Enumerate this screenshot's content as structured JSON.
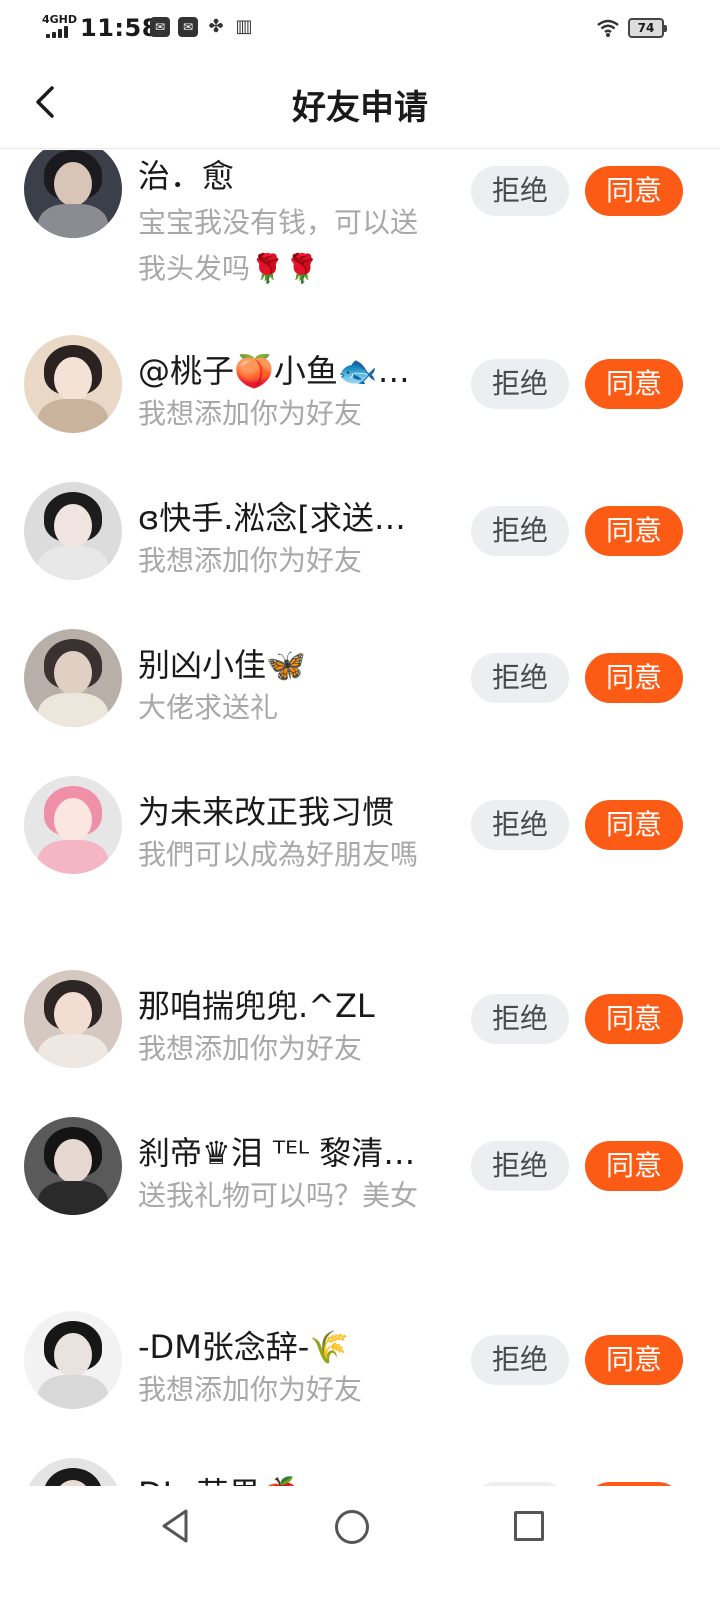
{
  "status_bar": {
    "network": "4GHD",
    "time": "11:58",
    "battery": "74"
  },
  "header": {
    "title": "好友申请"
  },
  "buttons": {
    "reject": "拒绝",
    "accept": "同意"
  },
  "requests": [
    {
      "name": "治．愈",
      "message": "宝宝我没有钱，可以送我头发吗🌹🌹"
    },
    {
      "name": "@桃子🍑小鱼🐟…",
      "message": "我想添加你为好友"
    },
    {
      "name": "ɞ快手.淞念[求送…",
      "message": "我想添加你为好友"
    },
    {
      "name": "别凶小佳🦋",
      "message": "大佬求送礼"
    },
    {
      "name": "为未来改正我习惯",
      "message": "我們可以成為好朋友嗎"
    },
    {
      "name": "那咱揣兜兜.^ZL",
      "message": "我想添加你为好友"
    },
    {
      "name": "刹帝♛泪 ᵀᴱᴸ 黎清…",
      "message": "送我礼物可以吗？美女"
    },
    {
      "name": "-DM张念辞-🌾",
      "message": "我想添加你为好友"
    },
    {
      "name": "DL_苹果🍎",
      "message": ""
    }
  ],
  "colors": {
    "accept_bg": "#fb5b15",
    "reject_bg": "#eceef2",
    "message_text": "#a8a8a8"
  },
  "nav": {
    "back_icon": "triangle-back-icon",
    "home_icon": "circle-home-icon",
    "recent_icon": "square-recent-icon"
  }
}
